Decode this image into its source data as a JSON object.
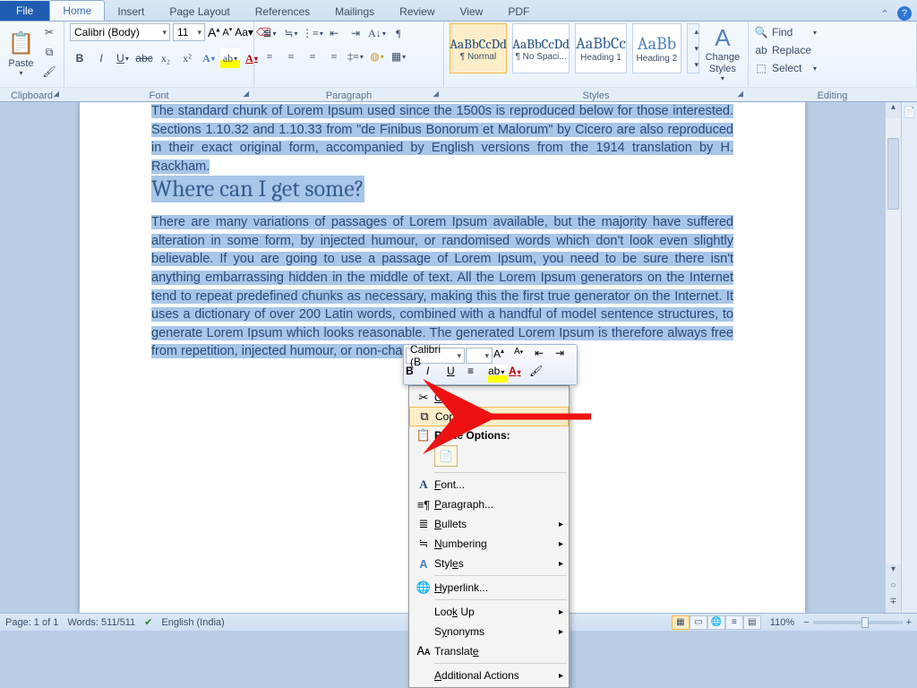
{
  "tabs": {
    "file": "File",
    "home": "Home",
    "insert": "Insert",
    "page_layout": "Page Layout",
    "references": "References",
    "mailings": "Mailings",
    "review": "Review",
    "view": "View",
    "pdf": "PDF"
  },
  "ribbon": {
    "clipboard": {
      "label": "Clipboard",
      "paste": "Paste"
    },
    "font": {
      "label": "Font",
      "family": "Calibri (Body)",
      "size": "11"
    },
    "paragraph": {
      "label": "Paragraph"
    },
    "styles": {
      "label": "Styles",
      "items": [
        {
          "sample": "AaBbCcDd",
          "name": "¶ Normal"
        },
        {
          "sample": "AaBbCcDd",
          "name": "¶ No Spaci..."
        },
        {
          "sample": "AaBbCc",
          "name": "Heading 1"
        },
        {
          "sample": "AaBb",
          "name": "Heading 2"
        }
      ],
      "change": "Change Styles"
    },
    "editing": {
      "label": "Editing",
      "find": "Find",
      "replace": "Replace",
      "select": "Select"
    }
  },
  "doc": {
    "p1": "The standard chunk of Lorem Ipsum used since the 1500s is reproduced below for those interested. Sections 1.10.32 and 1.10.33 from \"de Finibus Bonorum et Malorum\" by Cicero are also reproduced in their exact original form, accompanied by English versions from the 1914 translation by H. Rackham.",
    "h1": "Where can I get some?",
    "p2a": "There are many variations of passages of Lorem Ipsum available, but the majority have suffered alteration in some form, by injected humour, or randomised words which don't look even slightly believable. If you are going to use a passage of Lorem Ipsum, you need to be sure there isn't anything embarrassing hidden in the middle of text. All the Lorem Ipsum generators on the Internet tend to repeat predefined chunks as necessary, making this the first true generator on the Internet. It uses a dictionary of over 200 Latin words, combined with a handful of model sentence structures, to generate Lorem Ipsum which looks reasonable. The generated Lorem Ipsum is therefore always free from repetition, injected humour, or non-characteristic words etc."
  },
  "minibar": {
    "font": "Calibri (B",
    "size": ""
  },
  "context": {
    "cut": "Cut",
    "copy": "Copy",
    "paste_options": "Paste Options:",
    "font": "Font...",
    "paragraph": "Paragraph...",
    "bullets": "Bullets",
    "numbering": "Numbering",
    "styles": "Styles",
    "hyperlink": "Hyperlink...",
    "lookup": "Look Up",
    "synonyms": "Synonyms",
    "translate": "Translate",
    "additional": "Additional Actions"
  },
  "status": {
    "page": "Page: 1 of 1",
    "words": "Words: 511/511",
    "lang": "English (India)",
    "zoom": "110%"
  }
}
